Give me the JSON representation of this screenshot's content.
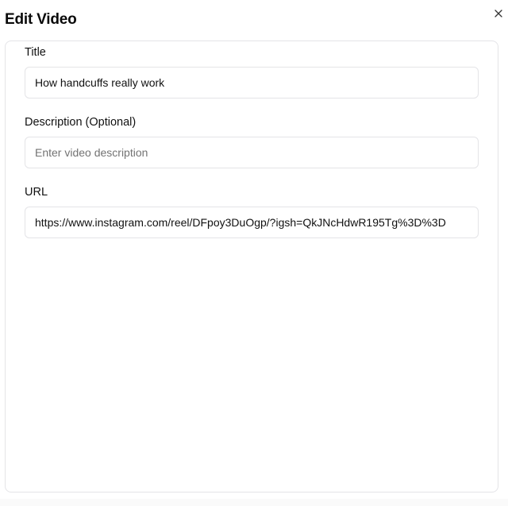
{
  "dialog": {
    "title": "Edit Video",
    "close_icon": "close-icon"
  },
  "form": {
    "title_label": "Title",
    "title_value": "How handcuffs really work",
    "description_label": "Description (Optional)",
    "description_value": "",
    "description_placeholder": "Enter video description",
    "url_label": "URL",
    "url_value": "https://www.instagram.com/reel/DFpoy3DuOgp/?igsh=QkJNcHdwR195Tg%3D%3D"
  }
}
